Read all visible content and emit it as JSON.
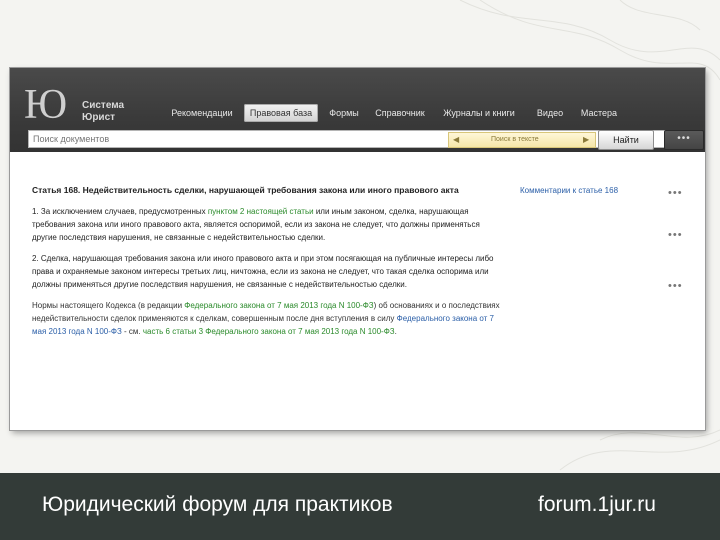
{
  "logo": {
    "mark": "Ю",
    "line1": "Система",
    "line2": "Юрист"
  },
  "nav": {
    "items": [
      {
        "label": "Рекомендации"
      },
      {
        "label": "Правовая база"
      },
      {
        "label": "Формы"
      },
      {
        "label": "Справочник"
      },
      {
        "label": "Журналы и книги"
      },
      {
        "label": "Видео"
      },
      {
        "label": "Мастера"
      }
    ],
    "active_index": 1
  },
  "search": {
    "placeholder": "Поиск документов",
    "filter_label": "Поиск в тексте",
    "filter_prev": "◀",
    "filter_next": "▶",
    "find_button": "Найти",
    "more_button": "•••"
  },
  "article": {
    "title": "Статья 168. Недействительность сделки, нарушающей требования закона или иного правового акта",
    "comment_link": "Комментарии к статье 168",
    "p1": {
      "prefix": "1. За исключением случаев, предусмотренных ",
      "link": "пунктом 2 настоящей статьи",
      "suffix": " или иным законом, сделка, нарушающая требования закона или иного правового акта, является оспоримой, если из закона не следует, что должны применяться другие последствия нарушения, не связанные с недействительностью сделки."
    },
    "p2": "2. Сделка, нарушающая требования закона или иного правового акта и при этом посягающая на публичные интересы либо права и охраняемые законом интересы третьих лиц, ничтожна, если из закона не следует, что такая сделка оспорима или должны применяться другие последствия нарушения, не связанные с недействительностью сделки.",
    "note": {
      "t1": "Нормы настоящего Кодекса (в редакции ",
      "l1": "Федерального закона от 7 мая 2013 года N 100-ФЗ",
      "t2": ") об основаниях и о последствиях недействительности сделок применяются к сделкам, совершенным после дня вступления в силу ",
      "l2": "Федерального закона от 7 мая 2013 года N 100-ФЗ",
      "t3": " - см. ",
      "l3": "часть 6 статьи 3 Федерального закона от 7 мая 2013 года N 100-ФЗ",
      "t4": "."
    }
  },
  "footer": {
    "left": "Юридический форум для практиков",
    "right": "forum.1jur.ru"
  }
}
